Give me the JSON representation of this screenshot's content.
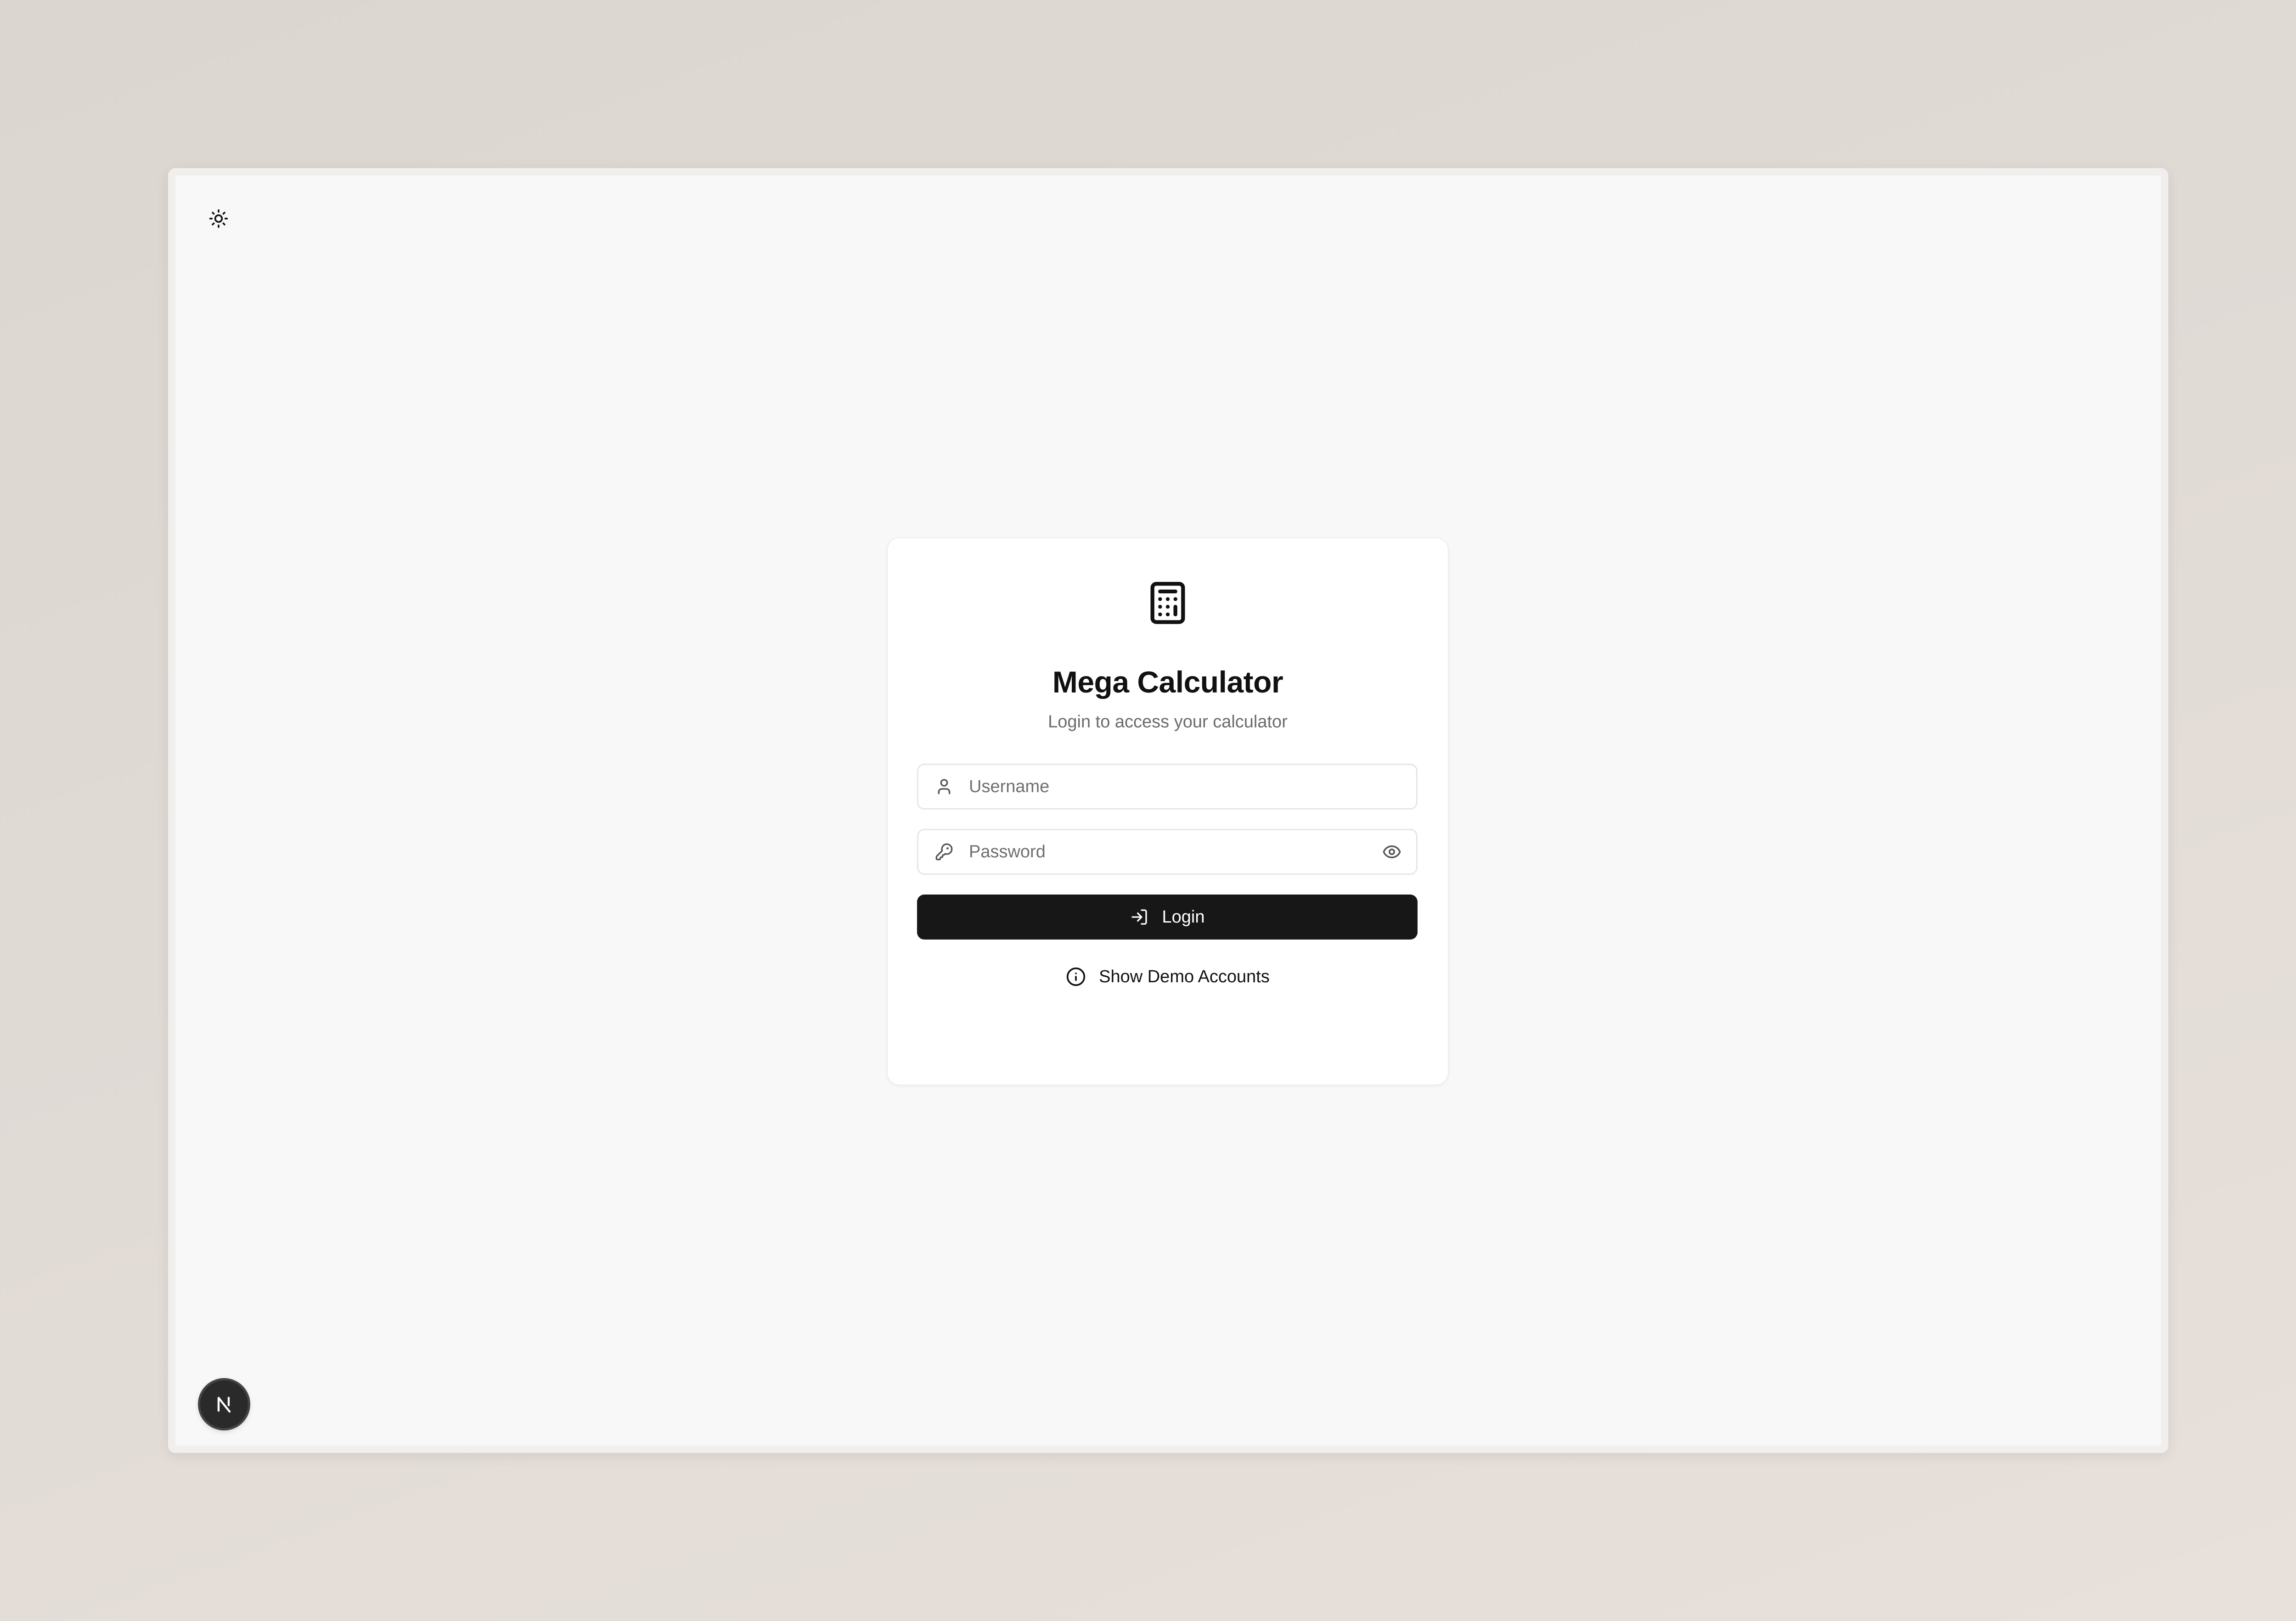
{
  "app": {
    "title": "Mega Calculator",
    "subtitle": "Login to access your calculator",
    "logo_icon": "calculator-icon"
  },
  "header": {
    "theme_toggle_icon": "sun-icon"
  },
  "form": {
    "username": {
      "icon": "user-icon",
      "placeholder": "Username",
      "value": ""
    },
    "password": {
      "icon": "key-icon",
      "placeholder": "Password",
      "value": "",
      "toggle_icon": "eye-icon"
    },
    "login_button": {
      "icon": "log-in-icon",
      "label": "Login"
    },
    "demo_link": {
      "icon": "info-icon",
      "label": "Show Demo Accounts"
    }
  },
  "dev_badge": {
    "icon": "nextjs-logo-icon",
    "letter": "N"
  },
  "colors": {
    "primary_button": "#171717",
    "card_background": "#ffffff",
    "page_background": "#f8f8f8",
    "muted_text": "#6b6b6b"
  }
}
